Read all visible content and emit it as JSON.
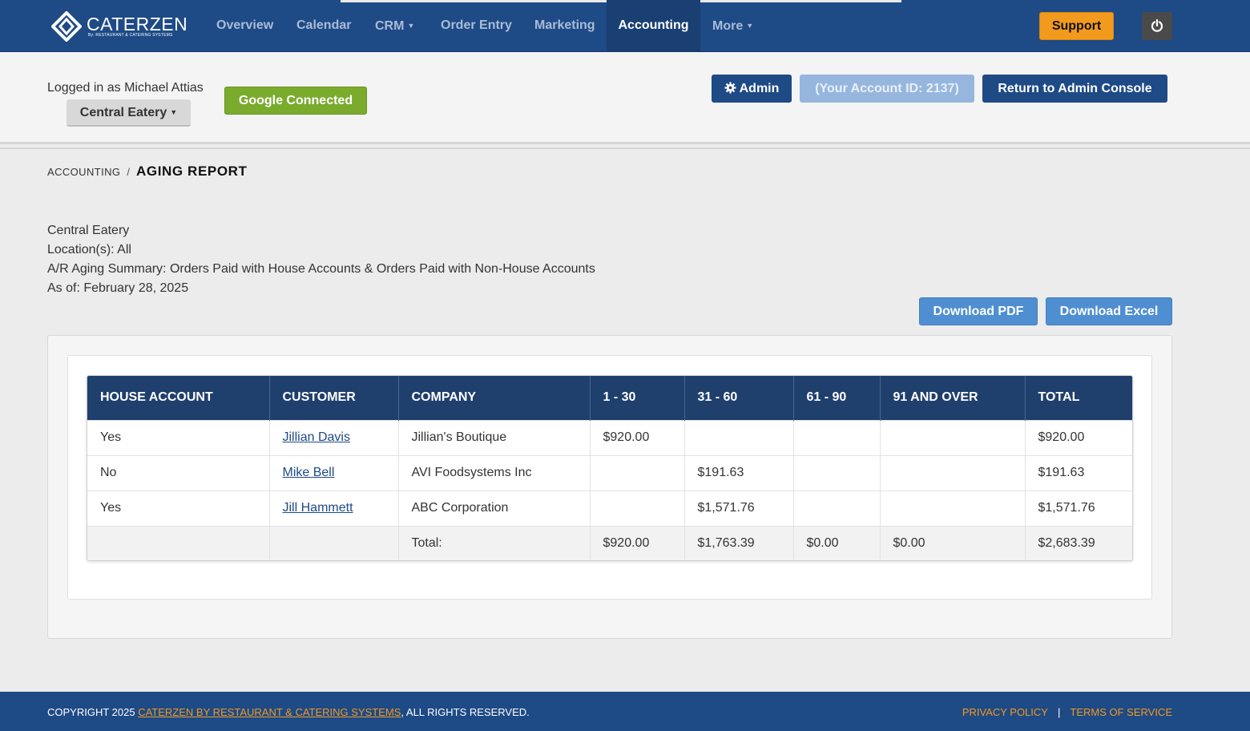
{
  "brand": {
    "name": "CATERZEN",
    "tagline": "By: RESTAURANT & CATERING SYSTEMS"
  },
  "nav": {
    "items": [
      {
        "label": "Overview"
      },
      {
        "label": "Calendar"
      },
      {
        "label": "CRM"
      },
      {
        "label": "Order Entry"
      },
      {
        "label": "Marketing"
      },
      {
        "label": "Accounting"
      },
      {
        "label": "More"
      }
    ],
    "active": "Accounting",
    "support_label": "Support",
    "power_icon": "power-icon"
  },
  "account": {
    "logged_in_text": "Logged in as Michael Attias",
    "location_label": "Central Eatery",
    "google_label": "Google Connected",
    "admin_label": "Admin",
    "account_id_label": "(Your Account ID: 2137)",
    "admin_console_label": "Return to Admin Console"
  },
  "breadcrumb": {
    "parent": "ACCOUNTING",
    "separator": "/",
    "current": "AGING REPORT"
  },
  "report": {
    "business": "Central Eatery",
    "locations": "Location(s): All",
    "summary": "A/R Aging Summary: Orders Paid with House Accounts & Orders Paid with Non-House Accounts",
    "as_of": "As of: February 28, 2025",
    "download_pdf": "Download PDF",
    "download_excel": "Download Excel"
  },
  "table": {
    "headers": [
      "HOUSE ACCOUNT",
      "CUSTOMER",
      "COMPANY",
      "1 - 30",
      "31 - 60",
      "61 - 90",
      "91 AND OVER",
      "TOTAL"
    ],
    "rows": [
      {
        "house_account": "Yes",
        "customer": "Jillian Davis",
        "company": "Jillian's Boutique",
        "d1_30": "$920.00",
        "d31_60": "",
        "d61_90": "",
        "d91_over": "",
        "total": "$920.00"
      },
      {
        "house_account": "No",
        "customer": "Mike Bell",
        "company": "AVI Foodsystems Inc",
        "d1_30": "",
        "d31_60": "$191.63",
        "d61_90": "",
        "d91_over": "",
        "total": "$191.63"
      },
      {
        "house_account": "Yes",
        "customer": "Jill Hammett",
        "company": "ABC Corporation",
        "d1_30": "",
        "d31_60": "$1,571.76",
        "d61_90": "",
        "d91_over": "",
        "total": "$1,571.76"
      }
    ],
    "totals": {
      "label": "Total:",
      "d1_30": "$920.00",
      "d31_60": "$1,763.39",
      "d61_90": "$0.00",
      "d91_over": "$0.00",
      "total": "$2,683.39"
    }
  },
  "footer": {
    "copyright_prefix": "COPYRIGHT 2025 ",
    "company_link": "CATERZEN BY RESTAURANT & CATERING SYSTEMS",
    "rights": ", ALL RIGHTS RESERVED.",
    "privacy": "PRIVACY POLICY",
    "separator": "|",
    "terms": "TERMS OF SERVICE"
  },
  "colors": {
    "navbar": "#1e4a86",
    "accent_orange": "#f29a1e",
    "google_green": "#7aab2d",
    "table_header": "#1f3f6d",
    "download_blue": "#4f8fd1"
  }
}
